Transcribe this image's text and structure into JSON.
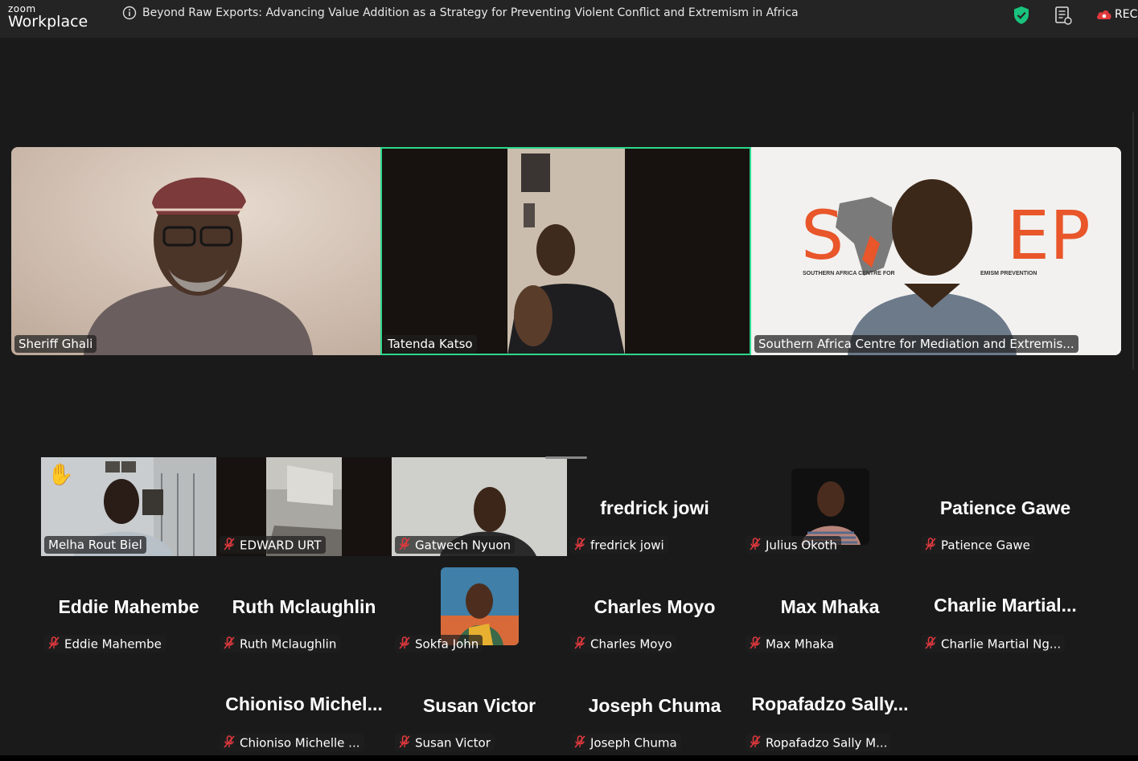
{
  "app": {
    "brand_small": "zoom",
    "brand_large": "Workplace"
  },
  "meeting": {
    "title": "Beyond Raw Exports: Advancing Value Addition as a Strategy for Preventing Violent Conflict and Extremism in Africa"
  },
  "toolbar": {
    "record_label": "REC"
  },
  "speakers": [
    {
      "name": "Sheriff Ghali"
    },
    {
      "name": "Tatenda Katso"
    },
    {
      "name": "Southern Africa Centre for Mediation and Extremis...",
      "logo_text_left": "S",
      "logo_text_right": "EP",
      "logo_caption": "SOUTHERN AFRICA CENTRE FOR",
      "logo_caption_right": "EMISM PREVENTION"
    }
  ],
  "gallery": [
    {
      "name": "Melha Rout Biel",
      "raised_hand": true
    },
    {
      "name": "EDWARD URT"
    },
    {
      "name": "Gatwech Nyuon"
    },
    {
      "name": "fredrick jowi",
      "display": "fredrick jowi"
    },
    {
      "name": "Julius Okoth"
    },
    {
      "name": "Patience Gawe",
      "display": "Patience Gawe"
    },
    {
      "name": "Eddie Mahembe",
      "display": "Eddie Mahembe"
    },
    {
      "name": "Ruth Mclaughlin",
      "display": "Ruth Mclaughlin"
    },
    {
      "name": "Sokfa John"
    },
    {
      "name": "Charles Moyo",
      "display": "Charles Moyo"
    },
    {
      "name": "Max Mhaka",
      "display": "Max Mhaka"
    },
    {
      "name": "Charlie Martial Ng...",
      "display": "Charlie  Martial..."
    },
    {
      "name": "Chioniso Michelle ...",
      "display": "Chioniso  Michel..."
    },
    {
      "name": "Susan Victor",
      "display": "Susan Victor"
    },
    {
      "name": "Joseph Chuma",
      "display": "Joseph Chuma"
    },
    {
      "name": "Ropafadzo Sally M...",
      "display": "Ropafadzo  Sally..."
    }
  ],
  "colors": {
    "active_speaker": "#2cd88c",
    "muted": "#e0393e",
    "shield": "#19c37d",
    "record": "#e0393e"
  }
}
